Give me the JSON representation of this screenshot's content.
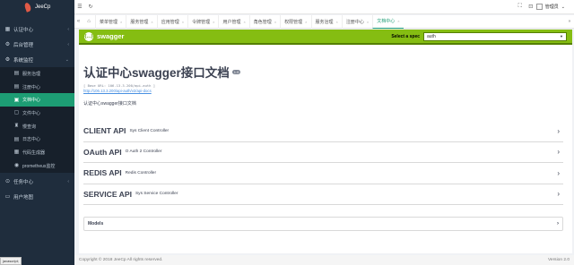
{
  "app": {
    "name": "JeeCp"
  },
  "sidebar": {
    "items": [
      {
        "label": "认证中心",
        "icon": "dashboard-icon"
      },
      {
        "label": "后台管理",
        "icon": "settings-icon"
      },
      {
        "label": "系统监控",
        "icon": "monitor-icon",
        "children": [
          {
            "label": "服务治理",
            "icon": "service-icon"
          },
          {
            "label": "注册中心",
            "icon": "registry-icon"
          },
          {
            "label": "文档中心",
            "icon": "document-icon",
            "active": true
          },
          {
            "label": "文件中心",
            "icon": "file-icon"
          },
          {
            "label": "慢查询",
            "icon": "slow-query-icon"
          },
          {
            "label": "日志中心",
            "icon": "log-icon"
          },
          {
            "label": "代码生成器",
            "icon": "code-icon"
          },
          {
            "label": "prometheus监控",
            "icon": "prometheus-icon"
          }
        ]
      },
      {
        "label": "任务中心",
        "icon": "task-icon"
      },
      {
        "label": "用户地图",
        "icon": "map-icon"
      }
    ],
    "status_tip": "javascript;"
  },
  "topbar": {
    "user": "管理员"
  },
  "tabs": [
    "菜单管理",
    "服务管理",
    "应用管理",
    "令牌管理",
    "用户管理",
    "角色管理",
    "权限管理",
    "服务治理",
    "注册中心",
    "文档中心"
  ],
  "active_tab_index": 9,
  "swagger": {
    "brand": "swagger",
    "spec_label": "Select a spec",
    "spec_value": "auth",
    "title": "认证中心swagger接口文档",
    "version": "1.0",
    "base_url": "[ Base URL: 106.13.3.200/api-auth ]",
    "doc_link": "http://106.13.3.200/api-auth/v2/api-docs",
    "description": "认证中心swagger接口文档",
    "apis": [
      {
        "name": "CLIENT API",
        "desc": "Sys Client Controller"
      },
      {
        "name": "OAuth API",
        "desc": "O Auth 2 Controller"
      },
      {
        "name": "REDIS API",
        "desc": "Redis Controller"
      },
      {
        "name": "SERVICE API",
        "desc": "Sys Service Controller"
      }
    ],
    "models_label": "Models"
  },
  "footer": {
    "copyright": "Copyright © 2018 JeeCp All rights reserved.",
    "version": "Version 2.0"
  },
  "colors": {
    "sidebar_bg": "#1f2d3d",
    "accent": "#1d9d74",
    "swagger_green": "#85bd12"
  }
}
